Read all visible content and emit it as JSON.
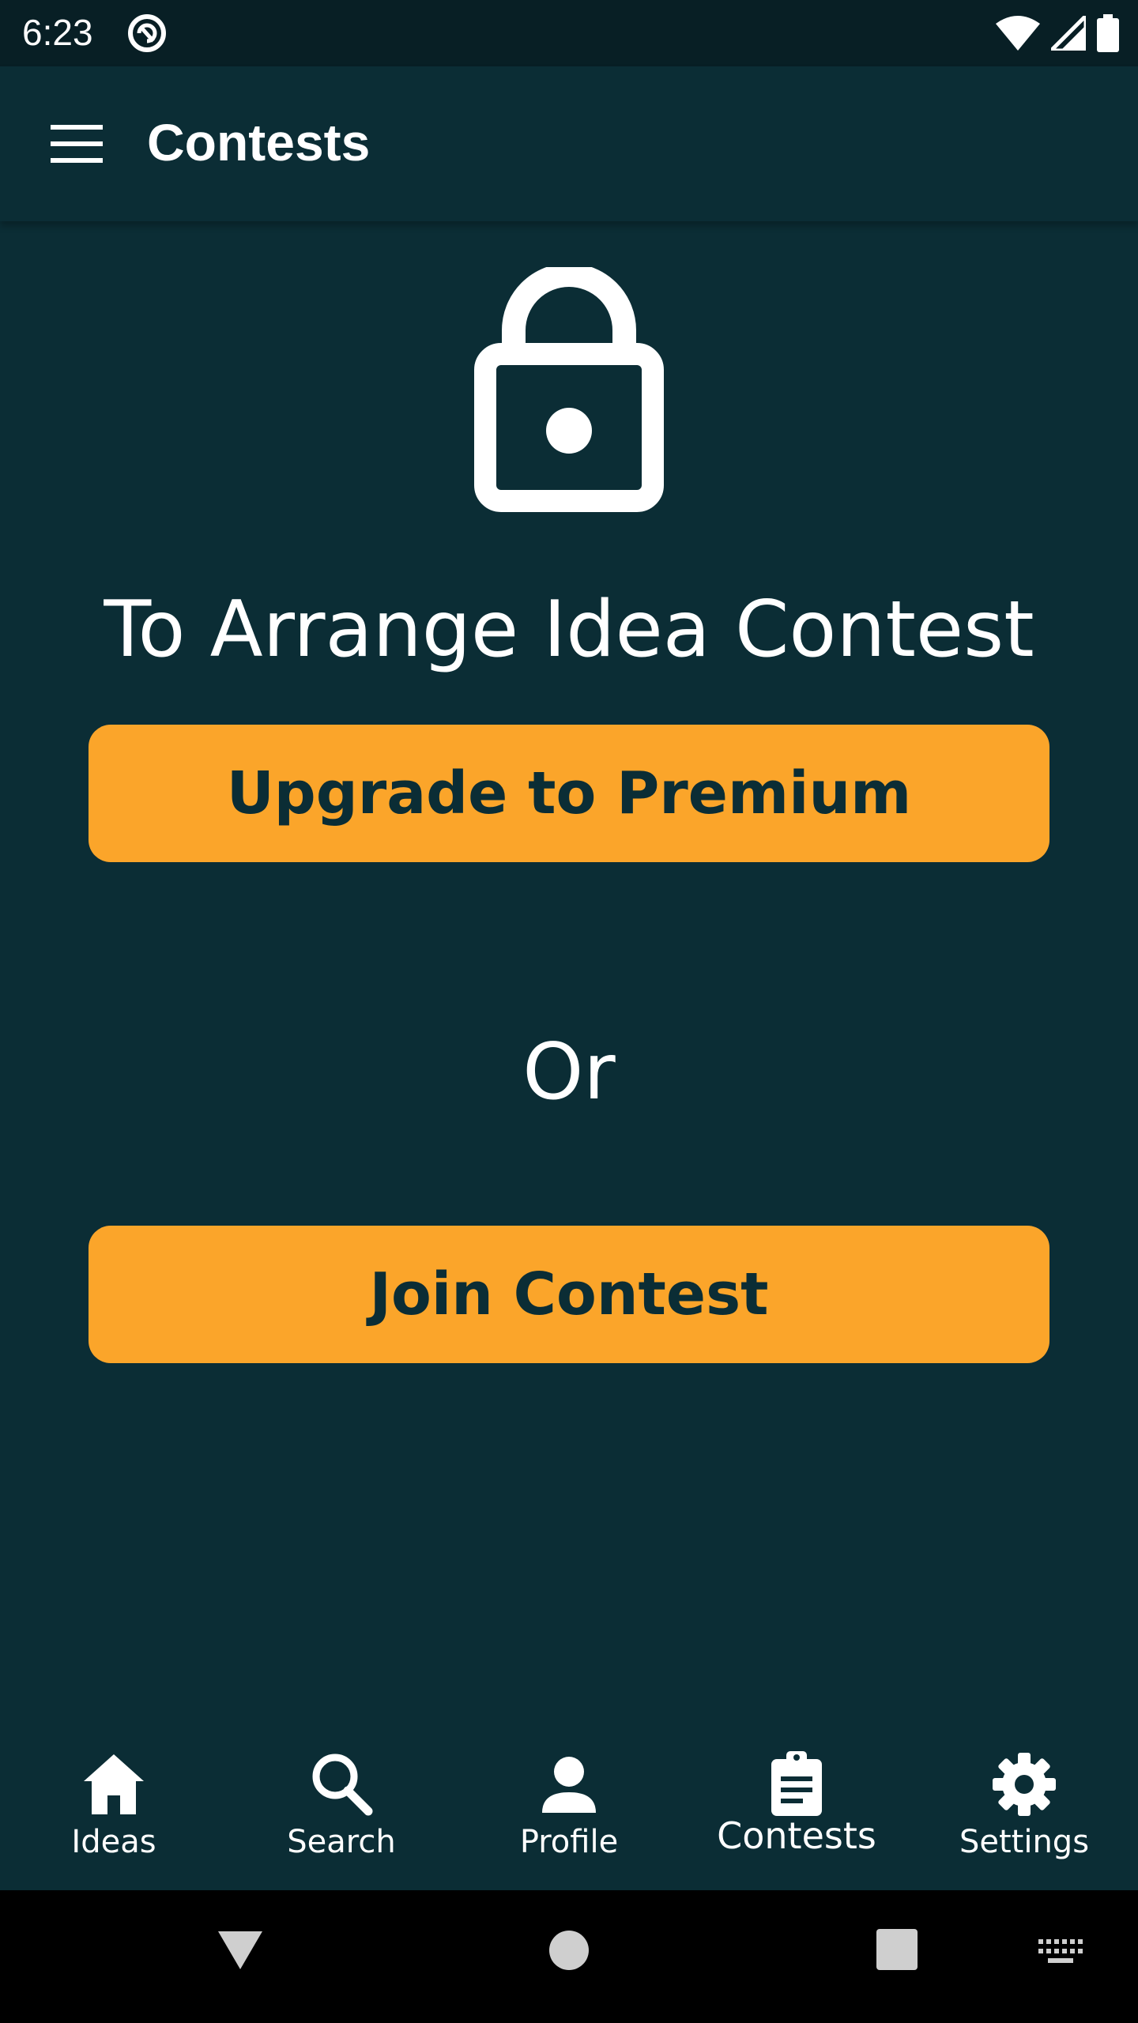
{
  "status_bar": {
    "time": "6:23",
    "icons": [
      "sync-icon",
      "wifi-icon",
      "signal-icon",
      "battery-icon"
    ]
  },
  "app_bar": {
    "title": "Contests",
    "menu_icon": "menu-icon"
  },
  "main": {
    "lock_icon": "lock-icon",
    "headline": "To Arrange Idea Contest",
    "upgrade_button": "Upgrade to Premium",
    "or_text": "Or",
    "join_button": "Join Contest"
  },
  "bottom_nav": {
    "items": [
      {
        "label": "Ideas",
        "icon": "home-icon"
      },
      {
        "label": "Search",
        "icon": "search-icon"
      },
      {
        "label": "Profile",
        "icon": "person-icon"
      },
      {
        "label": "Contests",
        "icon": "clipboard-icon",
        "active": true
      },
      {
        "label": "Settings",
        "icon": "gear-icon"
      }
    ]
  },
  "system_nav": {
    "icons": [
      "back-icon",
      "home-circle-icon",
      "recents-icon",
      "keyboard-icon"
    ]
  },
  "colors": {
    "background": "#0b2d35",
    "status_bar": "#081f25",
    "accent": "#fba52a",
    "button_text": "#0b2d35"
  }
}
